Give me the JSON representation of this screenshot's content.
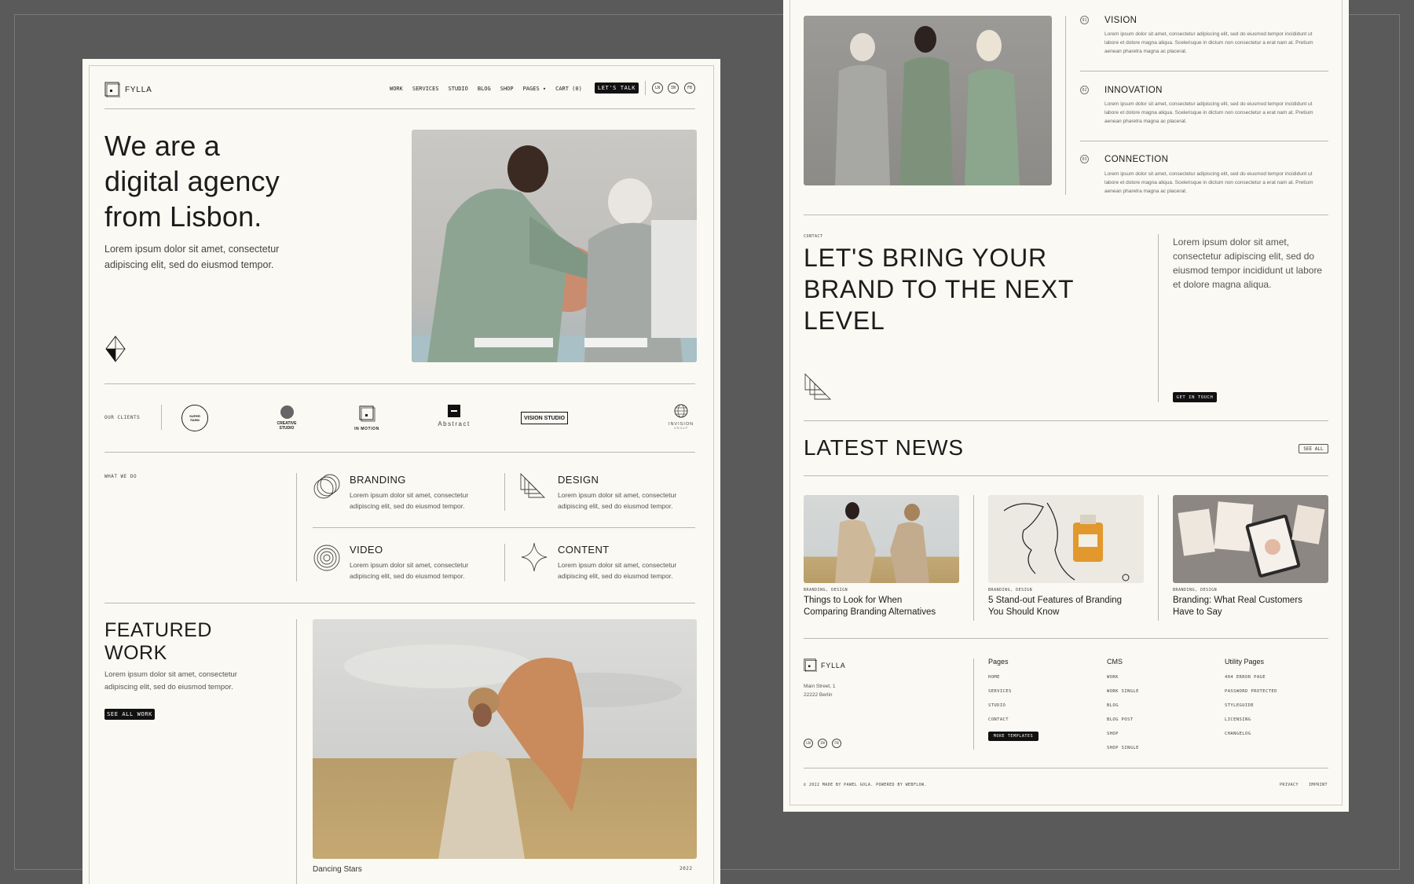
{
  "colors": {
    "background": "#5a5a5a",
    "page": "#fbf9f3",
    "ink": "#1c1c1c",
    "accent_dark": "#111111"
  },
  "left": {
    "brand": "FYLLA",
    "nav": [
      "WORK",
      "SERVICES",
      "STUDIO",
      "BLOG",
      "SHOP",
      "PAGES ▾",
      "CART (0)"
    ],
    "cta": "LET'S TALK",
    "social": [
      "LN",
      "IN",
      "FB"
    ],
    "hero_title": [
      "We are a",
      "digital agency",
      "from Lisbon."
    ],
    "hero_text": [
      "Lorem ipsum dolor sit amet, consectetur",
      "adipiscing elit, sed do eiusmod tempor."
    ],
    "clients_label": "OUR CLIENTS",
    "clients": [
      {
        "name": "SUPER FARM",
        "icon": "badge-circle-icon"
      },
      {
        "name": "CREATIVE STUDIO",
        "icon": "circle-logo-icon"
      },
      {
        "name": "IN MOTION",
        "icon": "square-logo-icon"
      },
      {
        "name": "Abstract",
        "icon": "abstract-square-icon"
      },
      {
        "name": "VISION STUDIO",
        "icon": "vision-box-icon"
      },
      {
        "name": "INVISION",
        "icon": "invision-globe-icon"
      },
      {
        "name": "GROUP",
        "icon": ""
      }
    ],
    "services_label": "WHAT WE DO",
    "services": [
      {
        "title": "BRANDING",
        "icon": "rings-icon",
        "text": [
          "Lorem ipsum dolor sit amet, consectetur",
          "adipiscing elit, sed do eiusmod tempor."
        ]
      },
      {
        "title": "DESIGN",
        "icon": "stacked-triangles-icon",
        "text": [
          "Lorem ipsum dolor sit amet, consectetur",
          "adipiscing elit, sed do eiusmod tempor."
        ]
      },
      {
        "title": "VIDEO",
        "icon": "concentric-circles-icon",
        "text": [
          "Lorem ipsum dolor sit amet, consectetur",
          "adipiscing elit, sed do eiusmod tempor."
        ]
      },
      {
        "title": "CONTENT",
        "icon": "sparkle-icon",
        "text": [
          "Lorem ipsum dolor sit amet, consectetur",
          "adipiscing elit, sed do eiusmod tempor."
        ]
      }
    ],
    "featured_title": [
      "FEATURED",
      "WORK"
    ],
    "featured_text": [
      "Lorem ipsum dolor sit amet, consectetur",
      "adipiscing elit, sed do eiusmod tempor."
    ],
    "featured_button": "SEE ALL WORK",
    "featured_caption": "Dancing Stars",
    "featured_year": "2022"
  },
  "right": {
    "pillars": [
      {
        "num": "01",
        "title": "VISION",
        "text": [
          "Lorem ipsum dolor sit amet, consectetur adipiscing elit, sed do eiusmod tempor incididunt ut",
          "labore et dolore magna aliqua. Scelerisque in dictum non consectetur a erat nam at. Pretium",
          "aenean pharetra magna ac placerat."
        ]
      },
      {
        "num": "02",
        "title": "INNOVATION",
        "text": [
          "Lorem ipsum dolor sit amet, consectetur adipiscing elit, sed do eiusmod tempor incididunt ut",
          "labore et dolore magna aliqua. Scelerisque in dictum non consectetur a erat nam at. Pretium",
          "aenean pharetra magna ac placerat."
        ]
      },
      {
        "num": "03",
        "title": "CONNECTION",
        "text": [
          "Lorem ipsum dolor sit amet, consectetur adipiscing elit, sed do eiusmod tempor incididunt ut",
          "labore et dolore magna aliqua. Scelerisque in dictum non consectetur a erat nam at. Pretium",
          "aenean pharetra magna ac placerat."
        ]
      }
    ],
    "contact_label": "CONTACT",
    "contact_title": [
      "LET'S BRING YOUR",
      "BRAND TO THE NEXT",
      "LEVEL"
    ],
    "contact_text": [
      "Lorem ipsum dolor sit amet,",
      "consectetur adipiscing elit, sed do",
      "eiusmod tempor incididunt ut labore",
      "et dolore magna aliqua."
    ],
    "contact_button": "GET IN TOUCH",
    "news_title": "LATEST NEWS",
    "news_button": "SEE ALL",
    "news": [
      {
        "tag": "BRANDING, DESIGN",
        "title": [
          "Things to Look for When",
          "Comparing Branding Alternatives"
        ]
      },
      {
        "tag": "BRANDING, DESIGN",
        "title": [
          "5 Stand-out Features of Branding",
          "You Should Know"
        ]
      },
      {
        "tag": "BRANDING, DESIGN",
        "title": [
          "Branding: What Real Customers",
          "Have to Say"
        ]
      }
    ],
    "footer_brand": "FYLLA",
    "footer_address": [
      "Main Street, 1",
      "22222 Berlin"
    ],
    "footer_social": [
      "LN",
      "IN",
      "FB"
    ],
    "footer_cols": [
      {
        "head": "Pages",
        "links": [
          "HOME",
          "SERVICES",
          "STUDIO",
          "CONTACT"
        ]
      },
      {
        "head": "CMS",
        "links": [
          "WORK",
          "WORK SINGLE",
          "BLOG",
          "BLOG POST",
          "SHOP",
          "SHOP SINGLE"
        ]
      },
      {
        "head": "Utility Pages",
        "links": [
          "404 ERROR PAGE",
          "PASSWORD PROTECTED",
          "STYLEGUIDE",
          "LICENSING",
          "CHANGELOG"
        ]
      }
    ],
    "more_templates": "MORE TEMPLATES",
    "copyright": "© 2022 MADE BY PAWEL GOLA. POWERED BY WEBFLOW.",
    "legal": [
      "PRIVACY",
      "IMPRINT"
    ]
  }
}
